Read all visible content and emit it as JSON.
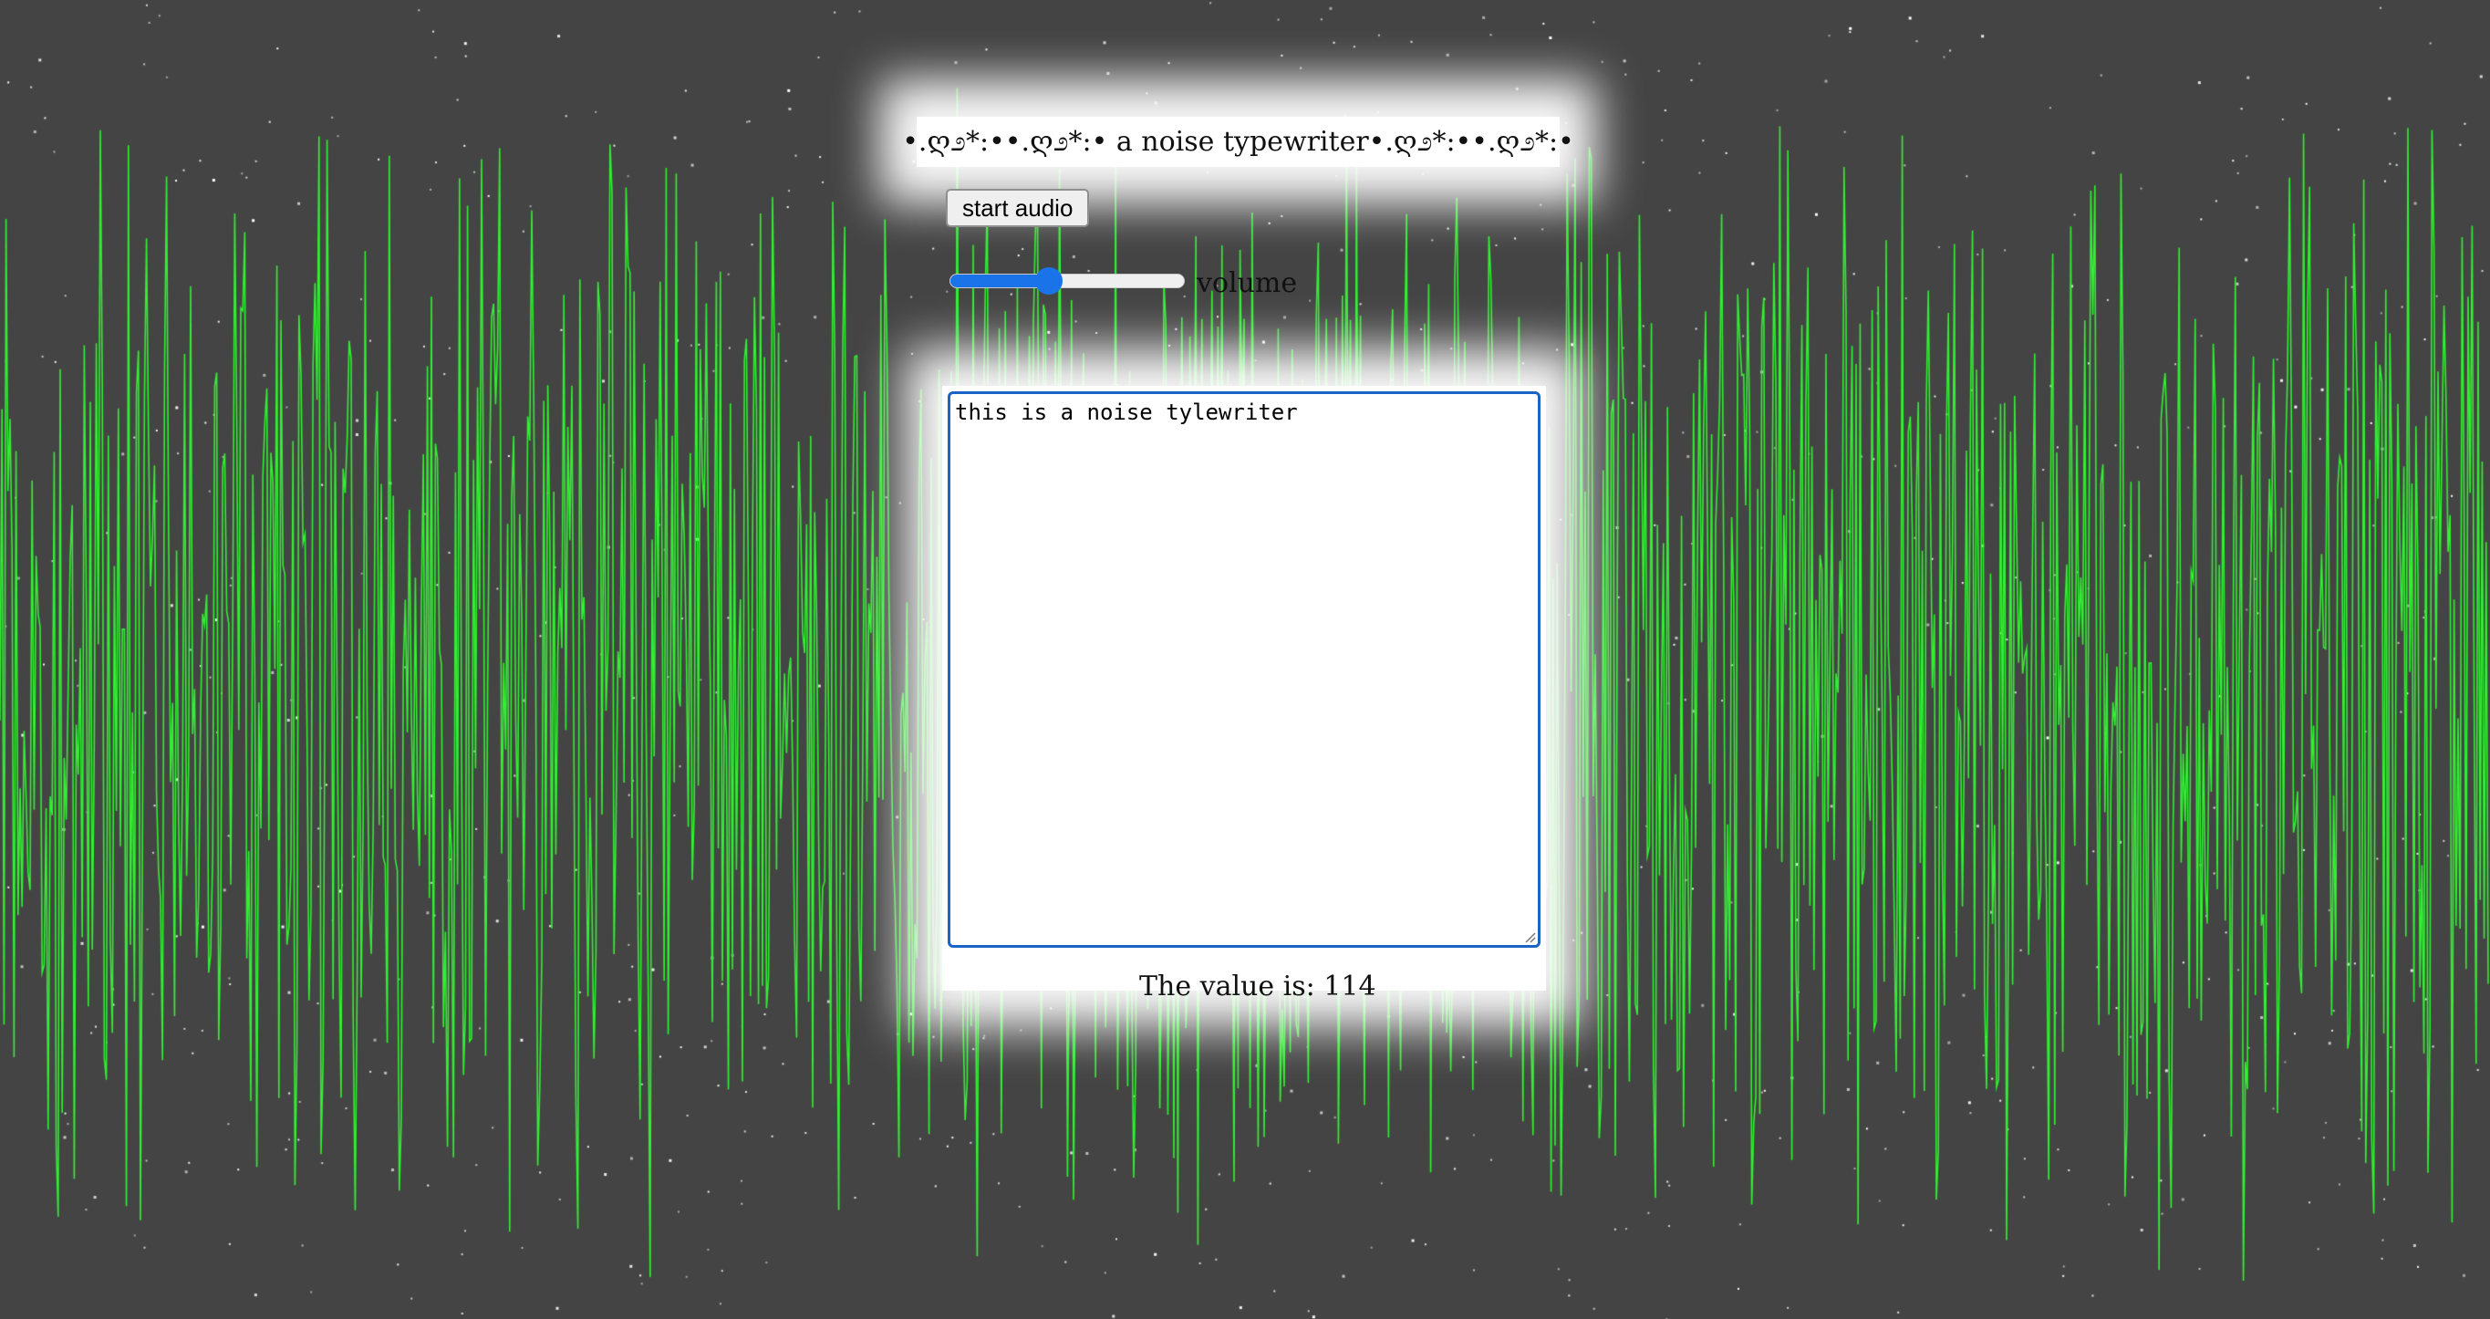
{
  "page": {
    "title": "•.ღ೨*:••.ღ೨*:• a noise typewriter•.ღ೨*:••.ღ೨*:•",
    "background_color": "#444444",
    "waveform_color": "#33ee33",
    "star_color": "#ffffff"
  },
  "controls": {
    "start_audio_label": "start audio",
    "volume_label": "volume",
    "volume_level": 0.42,
    "accent_color": "#1a73e8"
  },
  "editor": {
    "value": "this is a noise tylewriter"
  },
  "status": {
    "value_text": "The value is: 114"
  }
}
